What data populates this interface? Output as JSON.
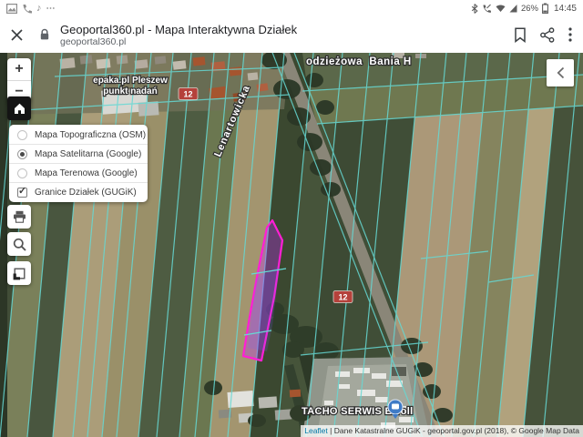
{
  "status_bar": {
    "time": "14:45",
    "battery_percent": "26%",
    "left_icons": [
      "screenshot-icon",
      "phone-icon",
      "music-note-icon",
      "more-notifications-icon"
    ],
    "music_note": "♪",
    "more_glyph": "⋯",
    "right_icons": [
      "bluetooth-icon",
      "phone-mute-icon",
      "wifi-icon",
      "signal-icon",
      "battery-icon"
    ]
  },
  "browser": {
    "title": "Geoportal360.pl - Mapa Interaktywna Działek",
    "url": "geoportal360.pl"
  },
  "map": {
    "controls": {
      "zoom_in": "+",
      "zoom_out": "−"
    },
    "layers_panel": {
      "items": [
        {
          "label": "Mapa Topograficzna (OSM)",
          "control": "radio",
          "checked": false
        },
        {
          "label": "Mapa Satelitarna (Google)",
          "control": "radio",
          "checked": true
        },
        {
          "label": "Mapa Terenowa (Google)",
          "control": "radio",
          "checked": false
        },
        {
          "label": "Granice Działek (GUGiK)",
          "control": "checkbox",
          "checked": true
        }
      ]
    },
    "labels": {
      "top_poi": "odzieżowa  Bania H",
      "epaka_line1": "epaka.pl Pleszew",
      "epaka_line2": "punkt nadań",
      "street": "Lenartowicka",
      "road_shield": "12",
      "tacho": "TACHO SERWIS E Toll"
    },
    "attribution": {
      "leaflet": "Leaflet",
      "text": "| Dane Katastralne GUGiK - geoportal.gov.pl (2018), © Google Map Data"
    },
    "colors": {
      "parcel_boundary": "#66d9d4",
      "selected_parcel_stroke": "#ff1fd4",
      "selected_parcel_fill": "#c32bff",
      "road_shield_bg": "#b5413b",
      "poi_pin": "#3f7bc6"
    }
  }
}
